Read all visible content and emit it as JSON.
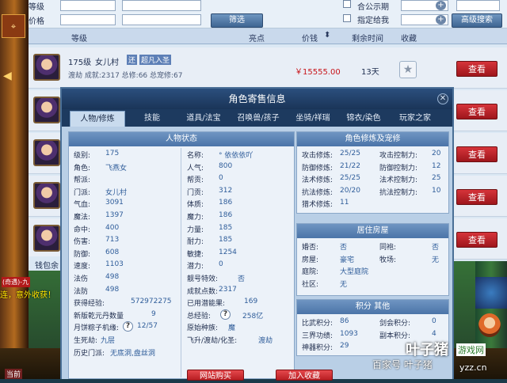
{
  "left_ui": {
    "chat_1": "(奇遇)-九",
    "chat_2": "连，意外收获！",
    "corner": "当前"
  },
  "filter": {
    "level_label": "等级",
    "price_label": "价格",
    "filter_button": "筛选",
    "public_label": "合公示期",
    "specified_label": "指定给我",
    "advanced_button": "高级搜索"
  },
  "table_header": {
    "level": "等级",
    "highlight": "亮点",
    "price": "价钱",
    "time_left": "剩余时间",
    "favorite": "收藏"
  },
  "listing": {
    "level_text": "175级",
    "school": "女儿村",
    "badge1": "还",
    "badge2": "超凡入圣",
    "line2": "渡劫 成就:2317 总修:66 总宠修:67",
    "price": "￥15555.00",
    "time_left": "13天",
    "view_button": "查看"
  },
  "view_buttons": [
    "查看",
    "查看",
    "查看",
    "查看",
    "查看"
  ],
  "wallet_label": "钱包余",
  "dialog": {
    "title": "角色寄售信息",
    "tabs": [
      "人物/修炼",
      "技能",
      "道具/法宝",
      "召唤兽/孩子",
      "坐骑/祥瑞",
      "锦衣/染色",
      "玩家之家"
    ],
    "status": {
      "title": "人物状态",
      "left": [
        {
          "k": "级别:",
          "v": "175"
        },
        {
          "k": "角色:",
          "v": "飞燕女"
        },
        {
          "k": "帮派:",
          "v": ""
        },
        {
          "k": "门派:",
          "v": "女儿村"
        },
        {
          "k": "气血:",
          "v": "3091"
        },
        {
          "k": "魔法:",
          "v": "1397"
        },
        {
          "k": "命中:",
          "v": "400"
        },
        {
          "k": "伤害:",
          "v": "713"
        },
        {
          "k": "防御:",
          "v": "608"
        },
        {
          "k": "速度:",
          "v": "1103"
        },
        {
          "k": "法伤",
          "v": "498"
        },
        {
          "k": "法防",
          "v": "498"
        },
        {
          "k": "获得经验:",
          "v": "572972275"
        },
        {
          "k": "新版乾元丹数量",
          "v": "9"
        },
        {
          "k": "月饼粽子机缘:",
          "v": "12/57"
        },
        {
          "k": "生死劫:",
          "v": "九层"
        },
        {
          "k": "历史门派:",
          "v": "无底洞,盘丝洞"
        }
      ],
      "right": [
        {
          "k": "名称:",
          "v": "° 依依依吖"
        },
        {
          "k": "人气:",
          "v": "800"
        },
        {
          "k": "帮贡:",
          "v": "0"
        },
        {
          "k": "门贡:",
          "v": "312"
        },
        {
          "k": "体质:",
          "v": "186"
        },
        {
          "k": "魔力:",
          "v": "186"
        },
        {
          "k": "力量:",
          "v": "185"
        },
        {
          "k": "耐力:",
          "v": "185"
        },
        {
          "k": "敏捷:",
          "v": "1254"
        },
        {
          "k": "潜力:",
          "v": "0"
        },
        {
          "k": "靓号特效:",
          "v": "否"
        },
        {
          "k": "成就点数:",
          "v": "2317"
        },
        {
          "k": "已用潜能果:",
          "v": "169"
        },
        {
          "k": "总经验:",
          "v": "258亿"
        },
        {
          "k": "原始种族:",
          "v": "魔"
        },
        {
          "k": "飞升/渡劫/化圣:",
          "v": "渡劫"
        }
      ]
    },
    "cultivation": {
      "title": "角色修炼及宠修",
      "rows": [
        {
          "k1": "攻击修炼:",
          "v1": "25/25",
          "k2": "攻击控制力:",
          "v2": "20"
        },
        {
          "k1": "防御修炼:",
          "v1": "21/22",
          "k2": "防御控制力:",
          "v2": "12"
        },
        {
          "k1": "法术修炼:",
          "v1": "25/25",
          "k2": "法术控制力:",
          "v2": "25"
        },
        {
          "k1": "抗法修炼:",
          "v1": "20/20",
          "k2": "抗法控制力:",
          "v2": "10"
        },
        {
          "k1": "猎术修炼:",
          "v1": "11",
          "k2": "",
          "v2": ""
        }
      ]
    },
    "house": {
      "title": "居住房屋",
      "rows": [
        {
          "k1": "婚否:",
          "v1": "否",
          "k2": "同袍:",
          "v2": "否"
        },
        {
          "k1": "房屋:",
          "v1": "豪宅",
          "k2": "牧场:",
          "v2": "无"
        },
        {
          "k1": "庭院:",
          "v1": "大型庭院",
          "k2": "",
          "v2": ""
        },
        {
          "k1": "社区:",
          "v1": "无",
          "k2": "",
          "v2": ""
        }
      ]
    },
    "points": {
      "title": "积分 其他",
      "rows": [
        {
          "k1": "比武积分:",
          "v1": "86",
          "k2": "剑会积分:",
          "v2": "0"
        },
        {
          "k1": "三界功绩:",
          "v1": "1093",
          "k2": "副本积分:",
          "v2": "4"
        },
        {
          "k1": "神器积分:",
          "v1": "29",
          "k2": "",
          "v2": ""
        }
      ]
    },
    "bottom_buttons": [
      "网站购买",
      "加入收藏"
    ]
  },
  "watermark": {
    "baijia": "百家号 叶子猪",
    "logo": "叶子猪",
    "logo_sub": "游戏网",
    "url": "yzz.cn"
  }
}
